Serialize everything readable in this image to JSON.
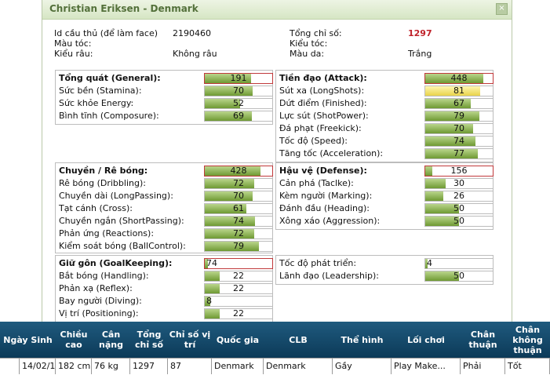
{
  "window": {
    "title": "Christian Eriksen - Denmark",
    "close_label": "×"
  },
  "info": {
    "id_label": "Id cầu thủ (để làm face)",
    "id_value": "2190460",
    "hair_color_label": "Màu tóc:",
    "beard_label": "Kiểu râu:",
    "beard_value": "Không râu",
    "total_label": "Tổng chỉ số:",
    "total_value": "1297",
    "hairstyle_label": "Kiểu tóc:",
    "skin_label": "Màu da:",
    "skin_value": "Trắng"
  },
  "groups": {
    "general": {
      "title": "Tổng quát (General):",
      "value": 191,
      "rows": [
        {
          "name": "Sức bền (Stamina):",
          "value": 70
        },
        {
          "name": "Sức khỏe Energy:",
          "value": 52
        },
        {
          "name": "Bình tĩnh (Composure):",
          "value": 69
        }
      ]
    },
    "attack": {
      "title": "Tiền đạo (Attack):",
      "value": 448,
      "rows": [
        {
          "name": "Sút xa (LongShots):",
          "value": 81,
          "highlight": true
        },
        {
          "name": "Dứt điểm (Finished):",
          "value": 67
        },
        {
          "name": "Lực sút (ShotPower):",
          "value": 79
        },
        {
          "name": "Đá phạt (Freekick):",
          "value": 70
        },
        {
          "name": "Tốc độ (Speed):",
          "value": 74
        },
        {
          "name": "Tăng tốc (Acceleration):",
          "value": 77
        }
      ]
    },
    "dribble": {
      "title": "Chuyền / Rê bóng:",
      "value": 428,
      "rows": [
        {
          "name": "Rê bóng (Dribbling):",
          "value": 72
        },
        {
          "name": "Chuyền dài (LongPassing):",
          "value": 70
        },
        {
          "name": "Tạt cánh (Cross):",
          "value": 61
        },
        {
          "name": "Chuyền ngắn (ShortPassing):",
          "value": 74
        },
        {
          "name": "Phản ứng (Reactions):",
          "value": 72
        },
        {
          "name": "Kiểm soát bóng (BallControl):",
          "value": 79
        }
      ]
    },
    "defense": {
      "title": "Hậu vệ (Defense):",
      "value": 156,
      "rows": [
        {
          "name": "Cản phá (Taclke):",
          "value": 30
        },
        {
          "name": "Kèm người (Marking):",
          "value": 26
        },
        {
          "name": "Đánh đầu (Heading):",
          "value": 50
        },
        {
          "name": "Xông xáo (Aggression):",
          "value": 50
        }
      ]
    },
    "keeping": {
      "title": "Giữ gôn (GoalKeeping):",
      "value": 74,
      "rows": [
        {
          "name": "Bắt bóng (Handling):",
          "value": 22
        },
        {
          "name": "Phản xạ (Reflex):",
          "value": 22
        },
        {
          "name": "Bay người (Diving):",
          "value": 8
        },
        {
          "name": "Vị trí (Positioning):",
          "value": 22
        }
      ]
    },
    "growth": {
      "rows": [
        {
          "name": "Tốc độ phát triển:",
          "value": 4
        },
        {
          "name": "Lãnh đạo (Leadership):",
          "value": 50
        }
      ]
    }
  },
  "table": {
    "headers": [
      "Ngày Sinh",
      "Chiều cao",
      "Cân nặng",
      "Tổng chỉ số",
      "Chỉ số vị trí",
      "Quốc gia",
      "CLB",
      "Thể hình",
      "Lối chơi",
      "Chân thuận",
      "Chân không thuận"
    ],
    "row": [
      "14/02/1992",
      "182 cm",
      "76 kg",
      "1297",
      "87",
      "Denmark",
      "Denmark",
      "Gầy",
      "Play Make...",
      "Phải",
      "Tốt"
    ]
  }
}
